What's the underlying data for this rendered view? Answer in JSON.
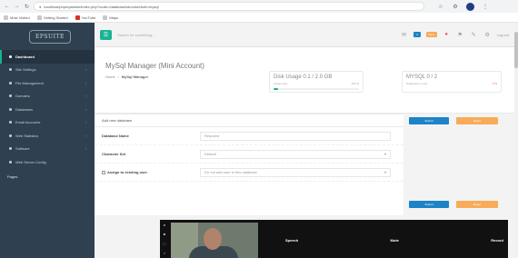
{
  "browser": {
    "url": "localhost/phpmyadmin/index.php?route=/database/structure&db=mysql",
    "bookmarks": [
      {
        "label": "Most Visited"
      },
      {
        "label": "Getting Started"
      },
      {
        "label": "YouTube"
      },
      {
        "label": "Maps"
      }
    ]
  },
  "sidebar": {
    "logo": "EPSUITE",
    "items": [
      {
        "label": "Dashboard",
        "active": true
      },
      {
        "label": "Site Settings"
      },
      {
        "label": "File Management"
      },
      {
        "label": "Domains"
      },
      {
        "label": "Databases"
      },
      {
        "label": "Email Accounts"
      },
      {
        "label": "Web Statistics"
      },
      {
        "label": "Software"
      },
      {
        "label": "Web Server Config"
      }
    ],
    "footer": "Pages"
  },
  "topbar": {
    "search_placeholder": "Search for something...",
    "badge_blue": "4",
    "badge_orange": "New",
    "link_text": "Log out"
  },
  "header": {
    "title": "MySql Manager (Mini Account)",
    "breadcrumb_home": "Home",
    "breadcrumb_current": "MySql Manager"
  },
  "widgets": {
    "disk": {
      "title": "Disk Usage 0.1 / 2.0 GB",
      "sub_left": "Usage ratio",
      "sub_right": "100 %",
      "fill_percent": 5
    },
    "mysql": {
      "title": "MYSQL 0 / 2",
      "sub_left": "Databases in use",
      "sub_right": "0 %"
    }
  },
  "form": {
    "panel_title": "Add new database",
    "rows": [
      {
        "label": "Database Name",
        "value": "",
        "placeholder": "Required"
      },
      {
        "label": "Character Set",
        "value": "Default"
      },
      {
        "label": "Assign to existing user",
        "value": "Do not add user to this database"
      }
    ],
    "buttons": {
      "primary": "Submit",
      "secondary": "Reset"
    }
  },
  "video": {
    "labels": [
      "Speech",
      "Mute",
      "Record"
    ]
  },
  "colors": {
    "sidebar": "#2f4050",
    "accent": "#1ab394",
    "primary": "#1c84c6",
    "warning": "#f8ac59"
  }
}
